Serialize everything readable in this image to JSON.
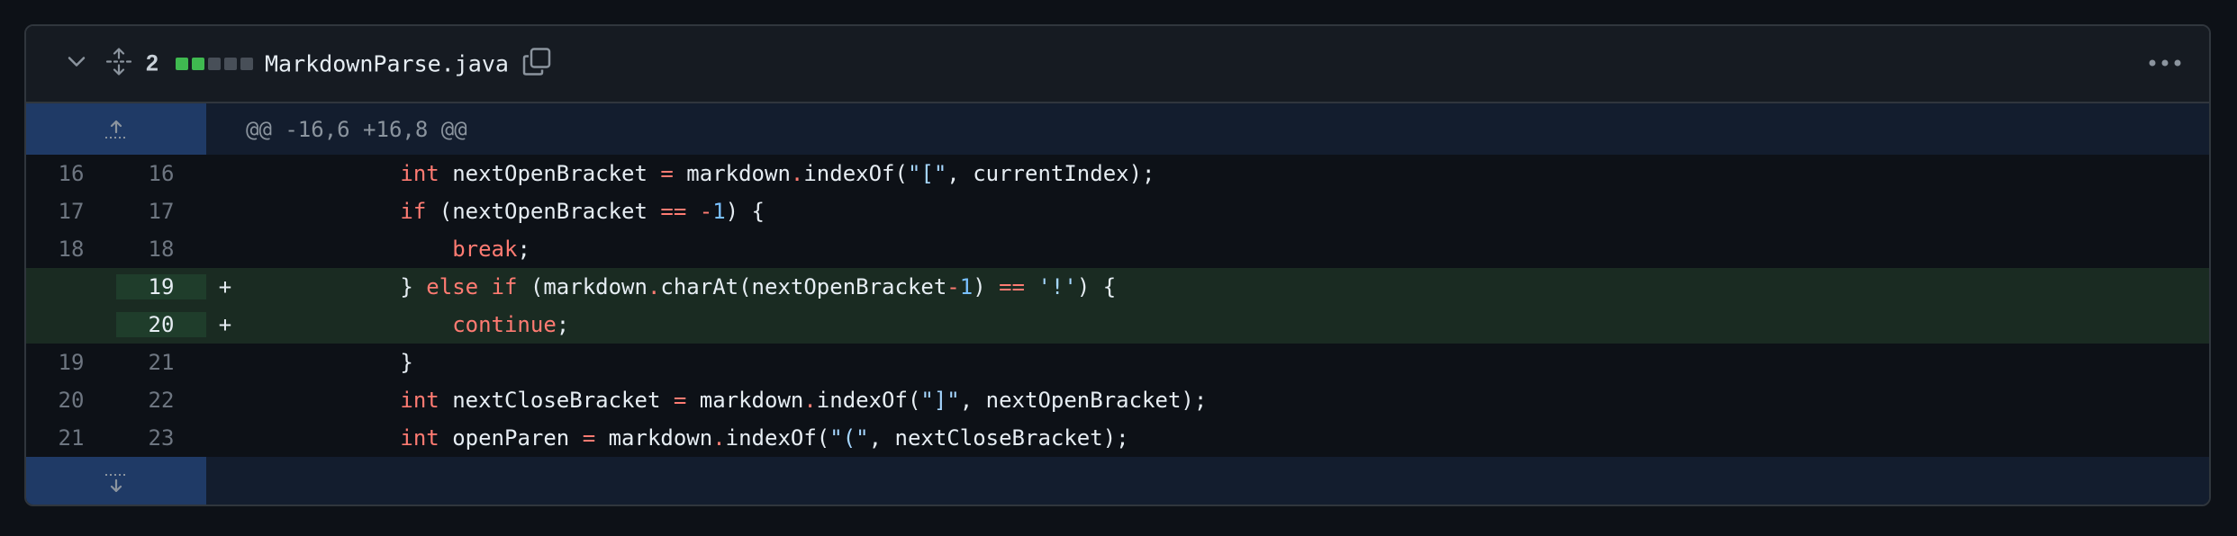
{
  "header": {
    "change_count": "2",
    "filename": "MarkdownParse.java",
    "stat_colors": [
      "#3fb950",
      "#3fb950",
      "#484f58",
      "#484f58",
      "#484f58"
    ]
  },
  "hunk": {
    "header_text": "@@ -16,6 +16,8 @@"
  },
  "lines": [
    {
      "old": "16",
      "new": "16",
      "marker": "",
      "type": "context"
    },
    {
      "old": "17",
      "new": "17",
      "marker": "",
      "type": "context"
    },
    {
      "old": "18",
      "new": "18",
      "marker": "",
      "type": "context"
    },
    {
      "old": "",
      "new": "19",
      "marker": "+",
      "type": "added"
    },
    {
      "old": "",
      "new": "20",
      "marker": "+",
      "type": "added"
    },
    {
      "old": "19",
      "new": "21",
      "marker": "",
      "type": "context"
    },
    {
      "old": "20",
      "new": "22",
      "marker": "",
      "type": "context"
    },
    {
      "old": "21",
      "new": "23",
      "marker": "",
      "type": "context"
    }
  ],
  "code": {
    "l1": {
      "indent": "            ",
      "kw": "int",
      "a": " nextOpenBracket ",
      "op": "=",
      "b": " markdown",
      "dot": ".",
      "c": "indexOf(",
      "str": "\"[\"",
      "d": ", currentIndex);"
    },
    "l2": {
      "indent": "            ",
      "kw": "if",
      "a": " (nextOpenBracket ",
      "op": "==",
      "b": " ",
      "neg": "-",
      "num": "1",
      "c": ") {"
    },
    "l3": {
      "indent": "                ",
      "kw": "break",
      "a": ";"
    },
    "l4": {
      "indent": "            ",
      "a": "} ",
      "kw1": "else",
      "sp": " ",
      "kw2": "if",
      "b": " (markdown",
      "dot": ".",
      "c": "charAt(nextOpenBracket",
      "neg": "-",
      "num": "1",
      "d": ") ",
      "op": "==",
      "e": " ",
      "str": "'!'",
      "f": ") {"
    },
    "l5": {
      "indent": "                ",
      "kw": "continue",
      "a": ";"
    },
    "l6": {
      "indent": "            ",
      "a": "}"
    },
    "l7": {
      "indent": "            ",
      "kw": "int",
      "a": " nextCloseBracket ",
      "op": "=",
      "b": " markdown",
      "dot": ".",
      "c": "indexOf(",
      "str": "\"]\"",
      "d": ", nextOpenBracket);"
    },
    "l8": {
      "indent": "            ",
      "kw": "int",
      "a": " openParen ",
      "op": "=",
      "b": " markdown",
      "dot": ".",
      "c": "indexOf(",
      "str": "\"(\"",
      "d": ", nextCloseBracket);"
    }
  }
}
